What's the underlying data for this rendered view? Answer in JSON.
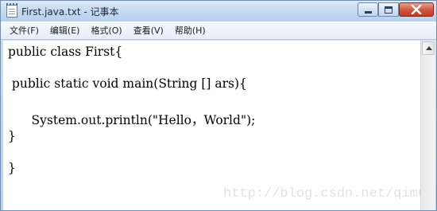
{
  "window": {
    "title": "First.java.txt - 记事本"
  },
  "menu": {
    "items": [
      {
        "label": "文件(F)"
      },
      {
        "label": "编辑(E)"
      },
      {
        "label": "格式(O)"
      },
      {
        "label": "查看(V)"
      },
      {
        "label": "帮助(H)"
      }
    ]
  },
  "editor": {
    "lines": [
      "public class First{",
      " public static void main(String [] ars){",
      "      System.out.println(\"Hello，World\");",
      "}",
      "}"
    ]
  },
  "watermark": "http://blog.csdn.net/qimu_",
  "icons": {
    "app": "notepad-icon",
    "minimize": "minimize-icon",
    "maximize": "maximize-icon",
    "close": "close-icon",
    "scroll_up": "arrow-up-icon"
  },
  "colors": {
    "close_button": "#c9432d",
    "title_bar": "#c8dbf1",
    "menu_bar": "#eef3fa",
    "editor_background": "#ffffff"
  }
}
